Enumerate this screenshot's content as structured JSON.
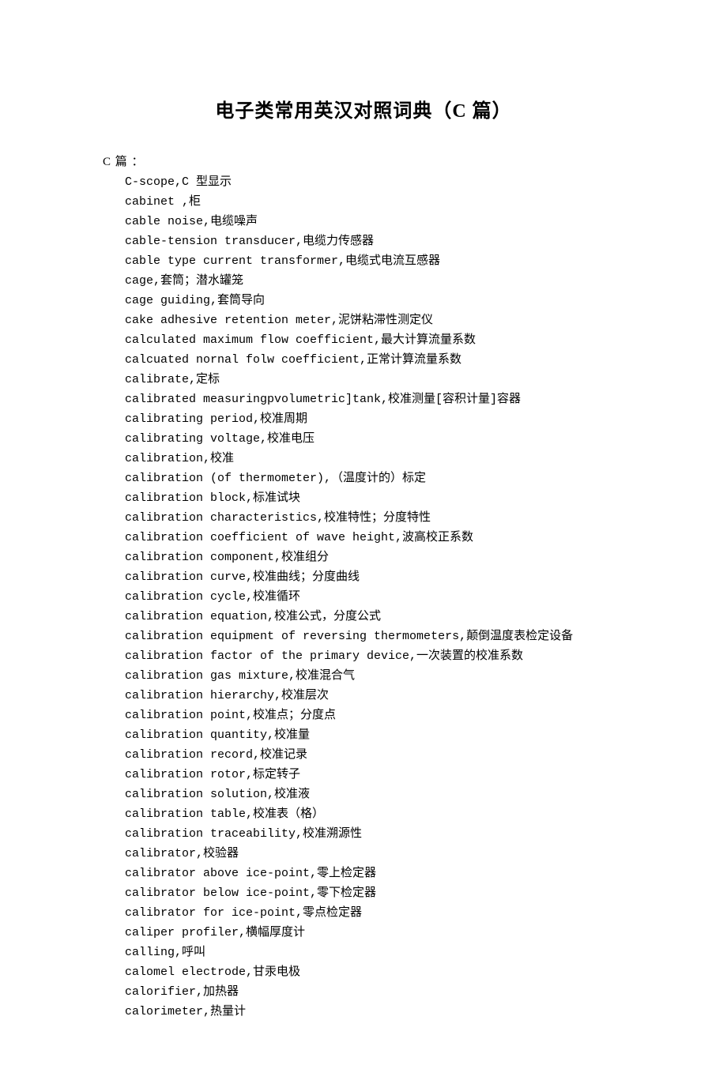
{
  "title": "电子类常用英汉对照词典（C 篇）",
  "section_header": "C 篇 ：",
  "entries": [
    "C-scope,C 型显示",
    "cabinet ,柜",
    "cable noise,电缆噪声",
    "cable-tension transducer,电缆力传感器",
    "cable type current transformer,电缆式电流互感器",
    "cage,套筒；潜水罐笼",
    "cage guiding,套筒导向",
    "cake adhesive retention meter,泥饼粘滞性测定仪",
    "calculated maximum flow coefficient,最大计算流量系数",
    "calcuated nornal folw coefficient,正常计算流量系数",
    "calibrate,定标",
    "calibrated measuringpvolumetric]tank,校准测量[容积计量]容器",
    "calibrating period,校准周期",
    "calibrating voltage,校准电压",
    "calibration,校准",
    "calibration (of thermometer),（温度计的）标定",
    "calibration block,标准试块",
    "calibration characteristics,校准特性；分度特性",
    "calibration coefficient of wave height,波高校正系数",
    "calibration component,校准组分",
    "calibration curve,校准曲线；分度曲线",
    "calibration cycle,校准循环",
    "calibration equation,校准公式，分度公式",
    "calibration equipment of reversing thermometers,颠倒温度表检定设备",
    "calibration factor of the primary device,一次装置的校准系数",
    "calibration gas mixture,校准混合气",
    "calibration hierarchy,校准层次",
    "calibration point,校准点；分度点",
    "calibration quantity,校准量",
    "calibration record,校准记录",
    "calibration rotor,标定转子",
    "calibration solution,校准液",
    "calibration table,校准表（格）",
    "calibration traceability,校准溯源性",
    "calibrator,校验器",
    "calibrator above ice-point,零上检定器",
    "calibrator below ice-point,零下检定器",
    "calibrator for ice-point,零点检定器",
    "caliper profiler,横幅厚度计",
    "calling,呼叫",
    "calomel electrode,甘汞电极",
    "calorifier,加热器",
    "calorimeter,热量计"
  ]
}
